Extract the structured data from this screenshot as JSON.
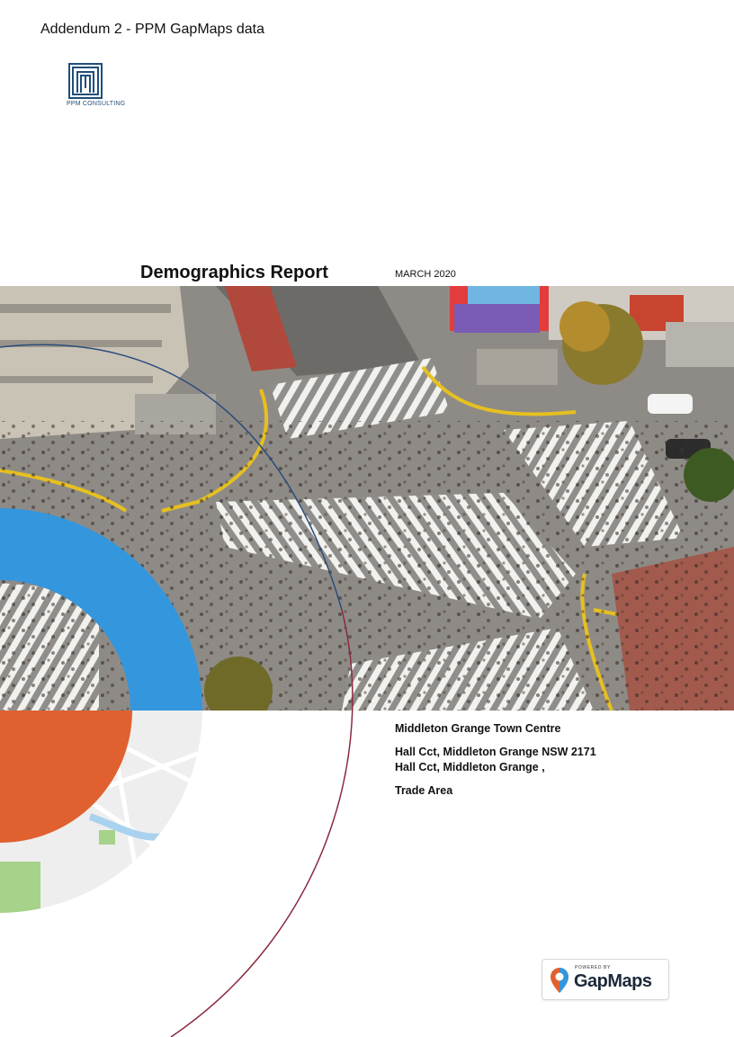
{
  "header": {
    "addendum_title": "Addendum 2 - PPM GapMaps data"
  },
  "logo": {
    "name": "PPM CONSULTING"
  },
  "report": {
    "title": "Demographics Report",
    "date": "MARCH 2020"
  },
  "cover_image": {
    "description_icon": "street-crossing-photo-icon"
  },
  "address": {
    "site_name": "Middleton Grange Town Centre",
    "line1": "Hall Cct, Middleton Grange NSW 2171",
    "line2": "Hall Cct, Middleton Grange ,",
    "area_type": "Trade Area"
  },
  "badge": {
    "powered_by": "POWERED BY",
    "brand": "GapMaps"
  },
  "colors": {
    "blue": "#3496dc",
    "orange": "#e0612f",
    "maroon": "#8b2a3e",
    "navy": "#1f4e79"
  }
}
